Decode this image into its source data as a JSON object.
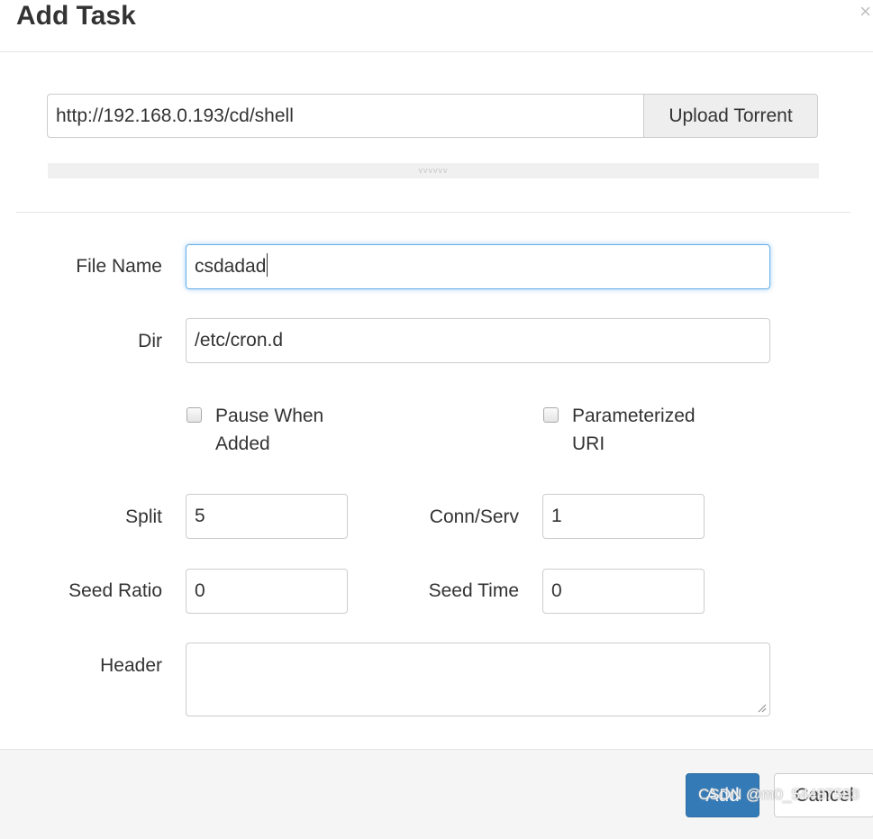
{
  "modal": {
    "title": "Add Task",
    "close_icon": "close-icon"
  },
  "url_section": {
    "url_value": "http://192.168.0.193/cd/shell",
    "upload_label": "Upload Torrent",
    "resize_handle": "vvvvvv"
  },
  "form": {
    "file_name_label": "File Name",
    "file_name_value": "csdadad",
    "dir_label": "Dir",
    "dir_value": "/etc/cron.d",
    "pause_when_added_label": "Pause When Added",
    "pause_when_added_checked": false,
    "parameterized_uri_label": "Parameterized URI",
    "parameterized_uri_checked": false,
    "split_label": "Split",
    "split_value": "5",
    "conn_serv_label": "Conn/Serv",
    "conn_serv_value": "1",
    "seed_ratio_label": "Seed Ratio",
    "seed_ratio_value": "0",
    "seed_time_label": "Seed Time",
    "seed_time_value": "0",
    "header_label": "Header",
    "header_value": ""
  },
  "footer": {
    "add_label": "Add",
    "cancel_label": "Cancel",
    "watermark": "CSDN @m0_54487583"
  },
  "colors": {
    "primary": "#337ab7",
    "focus_border": "#66afe9",
    "footer_bg": "#f5f5f5"
  }
}
